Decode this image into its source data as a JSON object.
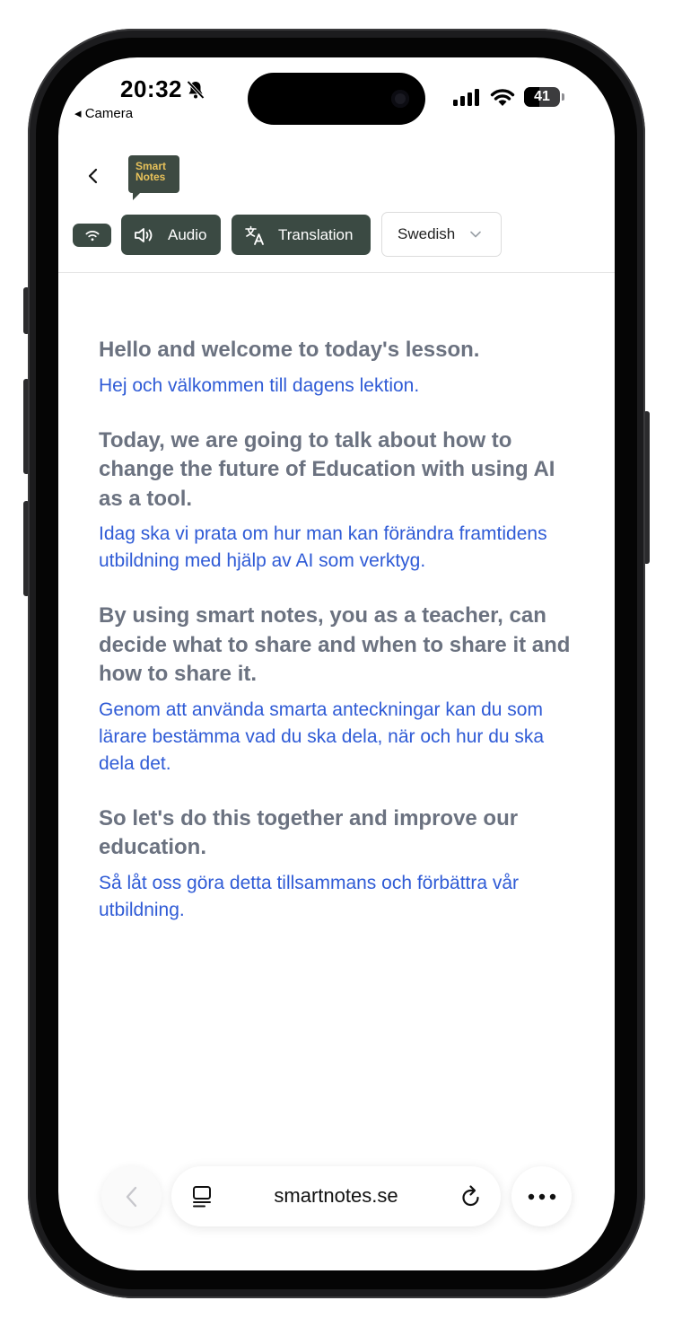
{
  "status_bar": {
    "time": "20:32",
    "back_app": "◂ Camera",
    "battery": "41"
  },
  "header": {
    "logo_line1": "Smart",
    "logo_line2": "Notes"
  },
  "toolbar": {
    "audio_label": "Audio",
    "translation_label": "Translation",
    "language_selected": "Swedish"
  },
  "lesson": {
    "items": [
      {
        "original": "Hello and welcome to today's lesson.",
        "translation": "Hej och välkommen till dagens lektion."
      },
      {
        "original": "Today, we are going to talk about how to change the future of Education with using AI as a tool.",
        "translation": "Idag ska vi prata om hur man kan förändra framtidens utbildning med hjälp av AI som verktyg."
      },
      {
        "original": "By using smart notes, you as a teacher, can decide what to share and when to share it and how to share it.",
        "translation": "Genom att använda smarta anteckningar kan du som lärare bestämma vad du ska dela, när och hur du ska dela det."
      },
      {
        "original": "So let's do this together and improve our education.",
        "translation": "Så låt oss göra detta tillsammans och förbättra vår utbildning."
      }
    ]
  },
  "browser": {
    "url": "smartnotes.se"
  },
  "icons": {
    "bell": "bell-slash-icon",
    "signal": "cellular-signal-icon",
    "wifi": "wifi-icon",
    "back": "chevron-left-icon",
    "audio": "speaker-icon",
    "translation": "translate-icon",
    "dropdown": "chevron-down-icon",
    "tabs": "tabs-icon",
    "reload": "reload-icon",
    "more": "more-icon"
  },
  "colors": {
    "brand_button": "#3b4a43",
    "logo_text": "#e7c15a",
    "original_text": "#6b7280",
    "translation_text": "#2f5bd6"
  }
}
